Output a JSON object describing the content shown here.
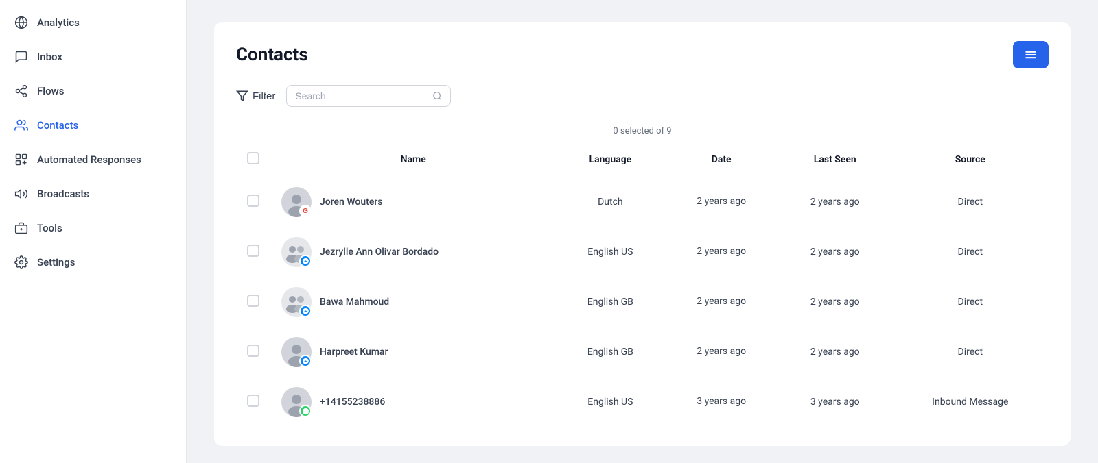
{
  "sidebar": {
    "items": [
      {
        "id": "analytics",
        "label": "Analytics",
        "icon": "globe"
      },
      {
        "id": "inbox",
        "label": "Inbox",
        "icon": "inbox"
      },
      {
        "id": "flows",
        "label": "Flows",
        "icon": "flows"
      },
      {
        "id": "contacts",
        "label": "Contacts",
        "icon": "contacts",
        "active": true
      },
      {
        "id": "automated-responses",
        "label": "Automated Responses",
        "icon": "automated"
      },
      {
        "id": "broadcasts",
        "label": "Broadcasts",
        "icon": "broadcasts"
      },
      {
        "id": "tools",
        "label": "Tools",
        "icon": "tools"
      },
      {
        "id": "settings",
        "label": "Settings",
        "icon": "settings"
      }
    ]
  },
  "page": {
    "title": "Contacts",
    "selection_info": "0 selected of 9",
    "filter_label": "Filter",
    "search_placeholder": "Search",
    "table": {
      "columns": [
        "Name",
        "Language",
        "Date",
        "Last Seen",
        "Source"
      ],
      "rows": [
        {
          "name": "Joren Wouters",
          "language": "Dutch",
          "date": "2 years ago",
          "last_seen": "2 years ago",
          "source": "Direct",
          "badge_type": "google"
        },
        {
          "name": "Jezrylle Ann Olivar Bordado",
          "language": "English US",
          "date": "2 years ago",
          "last_seen": "2 years ago",
          "source": "Direct",
          "badge_type": "messenger"
        },
        {
          "name": "Bawa Mahmoud",
          "language": "English GB",
          "date": "2 years ago",
          "last_seen": "2 years ago",
          "source": "Direct",
          "badge_type": "messenger"
        },
        {
          "name": "Harpreet Kumar",
          "language": "English GB",
          "date": "2 years ago",
          "last_seen": "2 years ago",
          "source": "Direct",
          "badge_type": "messenger"
        },
        {
          "name": "+14155238886",
          "language": "English US",
          "date": "3 years ago",
          "last_seen": "3 years ago",
          "source": "Inbound Message",
          "badge_type": "whatsapp"
        }
      ]
    }
  },
  "colors": {
    "accent": "#2563eb",
    "active_text": "#2563eb",
    "google_red": "#ea4335",
    "messenger_blue": "#0084ff",
    "whatsapp_green": "#25d366"
  }
}
